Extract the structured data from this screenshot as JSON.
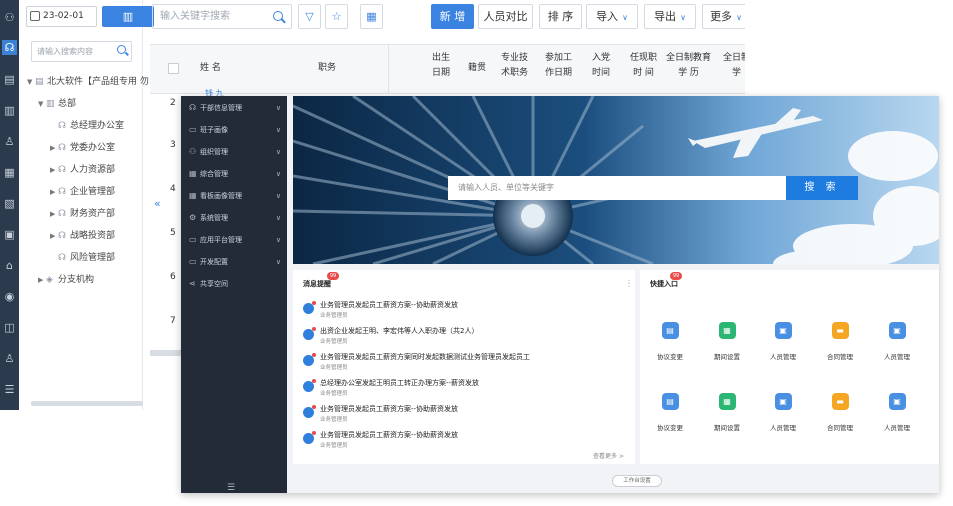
{
  "back": {
    "date_value": "23-02-01",
    "tree_search_placeholder": "请输入搜索内容",
    "tree": [
      {
        "label": "北大软件【产品组专用 勿",
        "level": 0
      },
      {
        "label": "总部",
        "level": 1
      },
      {
        "label": "总经理办公室",
        "level": 2
      },
      {
        "label": "党委办公室",
        "level": 2
      },
      {
        "label": "人力资源部",
        "level": 2
      },
      {
        "label": "企业管理部",
        "level": 2
      },
      {
        "label": "财务资产部",
        "level": 2
      },
      {
        "label": "战略投资部",
        "level": 2
      },
      {
        "label": "风险管理部",
        "level": 2
      },
      {
        "label": "分支机构",
        "level": 1
      }
    ],
    "keyword_placeholder": "输入关键字搜索",
    "toolbar": {
      "new_label": "新 增",
      "compare_label": "人员对比",
      "sort_label": "排 序",
      "import_label": "导入",
      "export_label": "导出",
      "more_label": "更多"
    },
    "columns": [
      "姓 名",
      "职务",
      "出生\n日期",
      "籍贯",
      "专业技\n术职务",
      "参加工\n作日期",
      "入党\n时间",
      "任现职\n时 间",
      "全日制教育\n学 历",
      "全日制\n学"
    ],
    "row_numbers": [
      "2",
      "3",
      "4",
      "5",
      "6",
      "7"
    ],
    "row_link": "钱 九"
  },
  "front": {
    "menu": [
      {
        "label": "干部信息管理",
        "icon": "people-icon"
      },
      {
        "label": "班子画像",
        "icon": "monitor-icon"
      },
      {
        "label": "组织管理",
        "icon": "org-chart-icon"
      },
      {
        "label": "综合管理",
        "icon": "grid-icon"
      },
      {
        "label": "看板画像管理",
        "icon": "grid-icon"
      },
      {
        "label": "系统管理",
        "icon": "gear-icon"
      },
      {
        "label": "应用平台管理",
        "icon": "monitor-icon"
      },
      {
        "label": "开发配置",
        "icon": "monitor-icon"
      },
      {
        "label": "共享空间",
        "icon": "share-icon"
      }
    ],
    "banner_search_placeholder": "请输入人员、单位等关键字",
    "banner_search_button": "搜 索",
    "messages_title": "消息提醒",
    "messages_badge": "99",
    "messages": [
      {
        "title": "业务管理员发起员工薪资方案--协助薪资发放",
        "sub": "业务管理员"
      },
      {
        "title": "出资企业发起王明、李宏伟等人入职办理（共2人）",
        "sub": "业务管理员"
      },
      {
        "title": "业务管理员发起员工薪资方案同时发起数据测试业务管理员发起员工",
        "sub": "业务管理员"
      },
      {
        "title": "总经理办公室发起王明员工转正办理方案--薪资发放",
        "sub": "业务管理员"
      },
      {
        "title": "业务管理员发起员工薪资方案--协助薪资发放",
        "sub": "业务管理员"
      },
      {
        "title": "业务管理员发起员工薪资方案--协助薪资发放",
        "sub": "业务管理员"
      }
    ],
    "view_more": "查看更多 >",
    "quick_title": "快捷入口",
    "quick_badge": "99",
    "quick_entries": [
      {
        "label": "协议变更",
        "color": "#4a90e2"
      },
      {
        "label": "期间设置",
        "color": "#2bb673"
      },
      {
        "label": "人员管理",
        "color": "#4a90e2"
      },
      {
        "label": "合同管理",
        "color": "#f5a623"
      },
      {
        "label": "人员管理",
        "color": "#4a90e2"
      },
      {
        "label": "协议变更",
        "color": "#4a90e2"
      },
      {
        "label": "期间设置",
        "color": "#2bb673"
      },
      {
        "label": "人员管理",
        "color": "#4a90e2"
      },
      {
        "label": "合同管理",
        "color": "#f5a623"
      },
      {
        "label": "人员管理",
        "color": "#4a90e2"
      }
    ],
    "workbench_settings": "工作台设置"
  }
}
